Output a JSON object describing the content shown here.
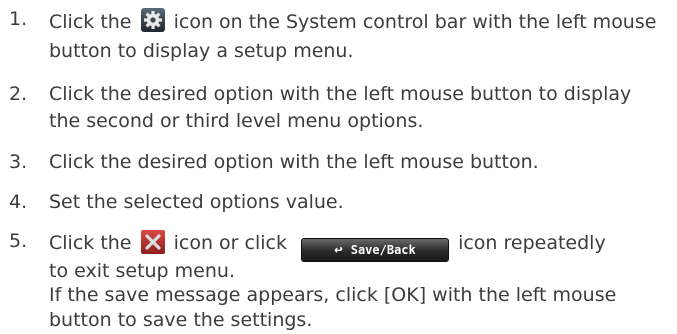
{
  "steps": [
    {
      "number": "1.",
      "lines": [
        {
          "before": "Click the",
          "after": "icon on the System control bar with the left mouse"
        },
        {
          "text": "button to display a setup menu."
        }
      ],
      "icon": "gear-settings-icon"
    },
    {
      "number": "2.",
      "lines": [
        {
          "text": "Click the desired option with the left mouse button to display"
        },
        {
          "text": "the second or third level menu options."
        }
      ]
    },
    {
      "number": "3.",
      "lines": [
        {
          "text": "Click the desired option with the left mouse button."
        }
      ]
    },
    {
      "number": "4.",
      "lines": [
        {
          "text": "Set the selected options value."
        }
      ]
    },
    {
      "number": "5.",
      "lines": [
        {
          "before": "Click the",
          "middle": "icon or click",
          "after": "icon repeatedly"
        },
        {
          "text": "to exit setup menu."
        },
        {
          "text": "If the save message appears, click [OK] with the left mouse"
        },
        {
          "text": "button to save the settings."
        }
      ],
      "icon": "close-x-icon",
      "button": {
        "label": "Save/Back",
        "icon": "return-arrow-icon"
      }
    }
  ]
}
